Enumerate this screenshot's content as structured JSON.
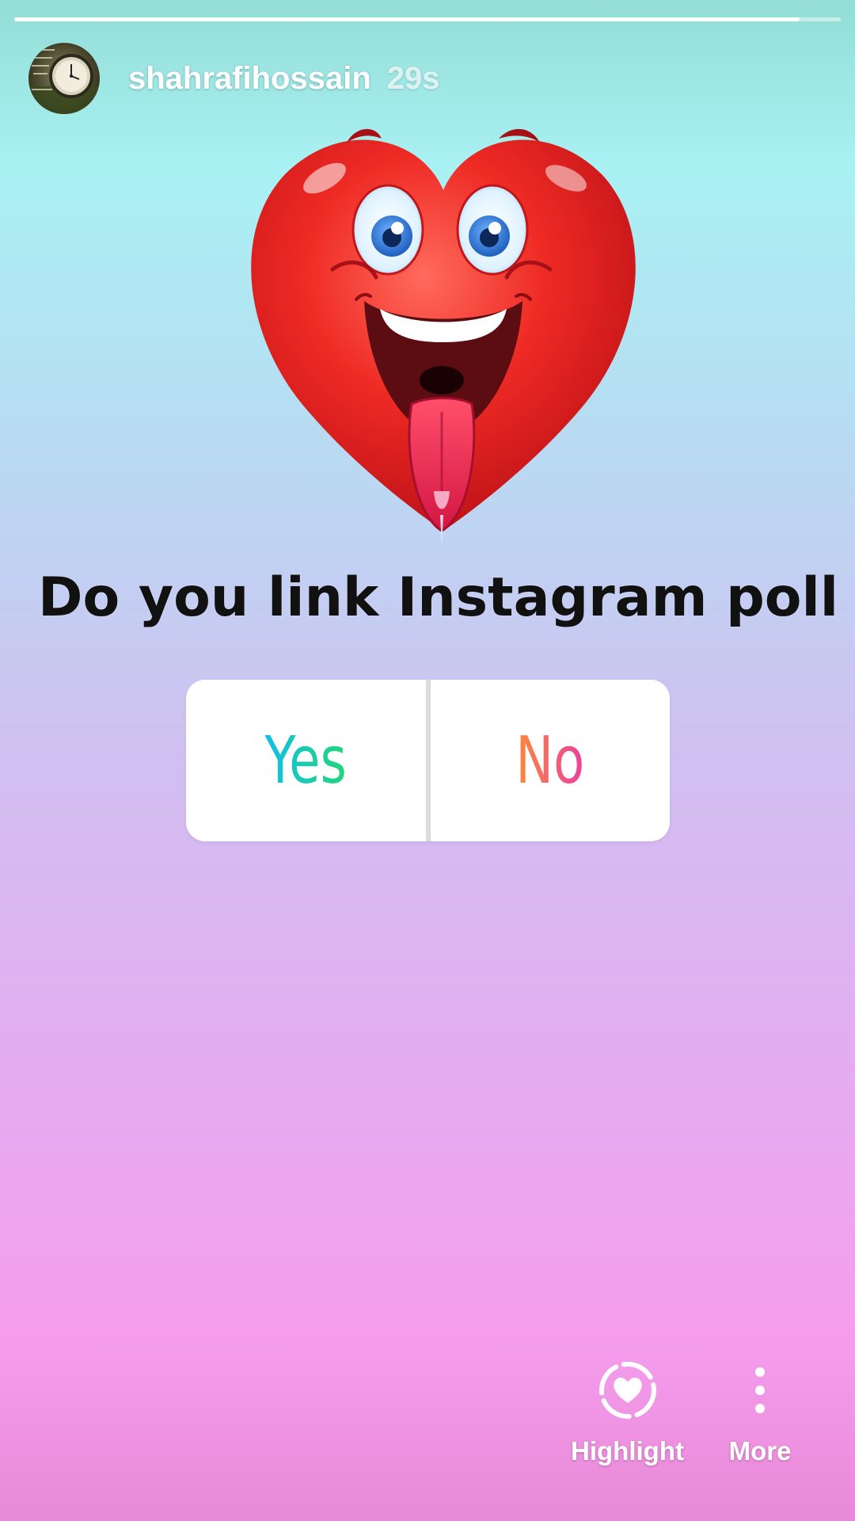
{
  "story": {
    "progress_fraction": 0.95,
    "username": "shahrafihossain",
    "timestamp": "29s",
    "question": "Do you link Instagram poll ???"
  },
  "poll": {
    "option_yes": "Yes",
    "option_no": "No"
  },
  "actions": {
    "highlight_label": "Highlight",
    "more_label": "More"
  },
  "icons": {
    "avatar": "clock-avatar",
    "sticker": "heart-face-sticker",
    "highlight": "highlight-heart-icon",
    "more": "more-vertical-icon"
  },
  "colors": {
    "background_top": "#93ddd6",
    "background_bottom": "#e889d7",
    "yes_gradient_start": "#10bfe6",
    "yes_gradient_end": "#22d679",
    "no_gradient_start": "#fb8a3a",
    "no_gradient_end": "#ec3f9e"
  }
}
